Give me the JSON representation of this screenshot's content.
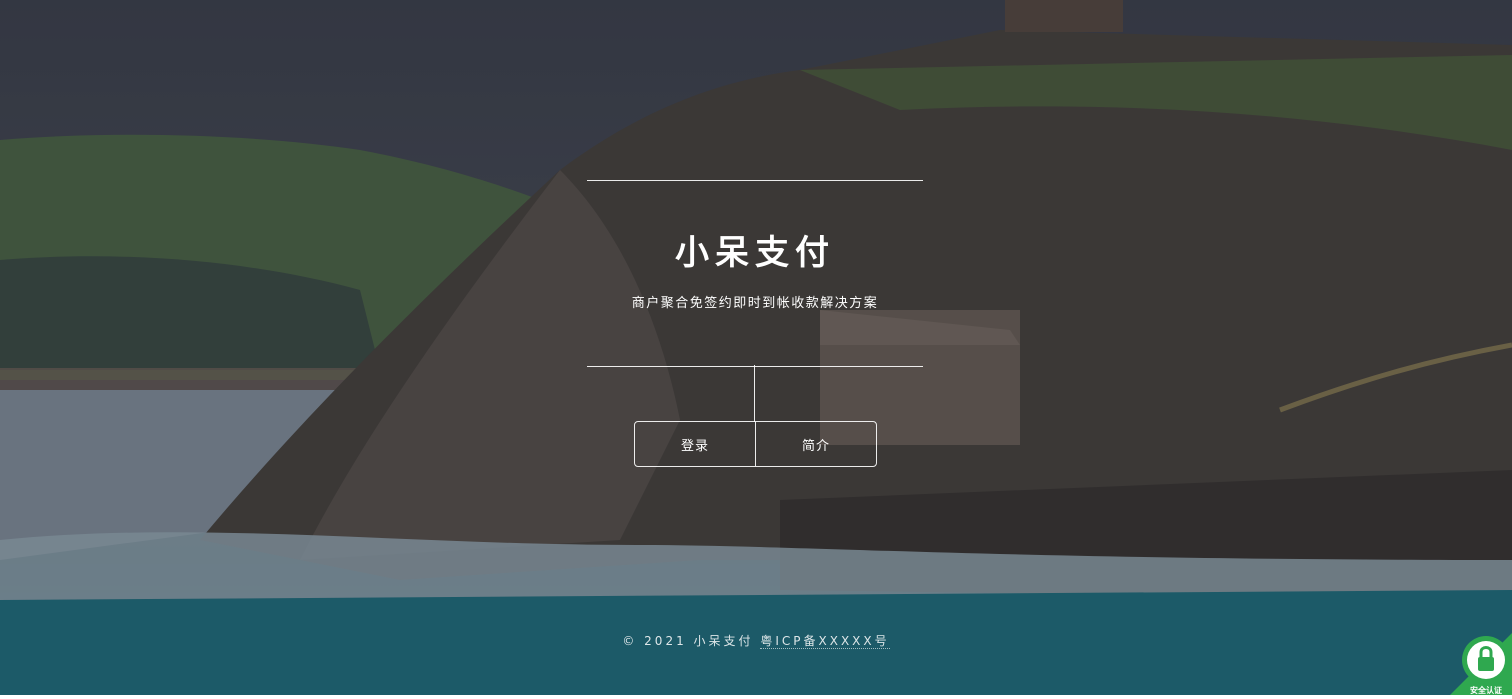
{
  "hero": {
    "title": "小呆支付",
    "subtitle": "商户聚合免签约即时到帐收款解决方案"
  },
  "nav": {
    "login_label": "登录",
    "intro_label": "简介"
  },
  "footer": {
    "copyright_prefix": "© 2021 小呆支付",
    "icp_text": "粤ICP备XXXXX号"
  },
  "badge": {
    "label": "安全认证"
  },
  "colors": {
    "badge_green": "#2fa84f"
  }
}
